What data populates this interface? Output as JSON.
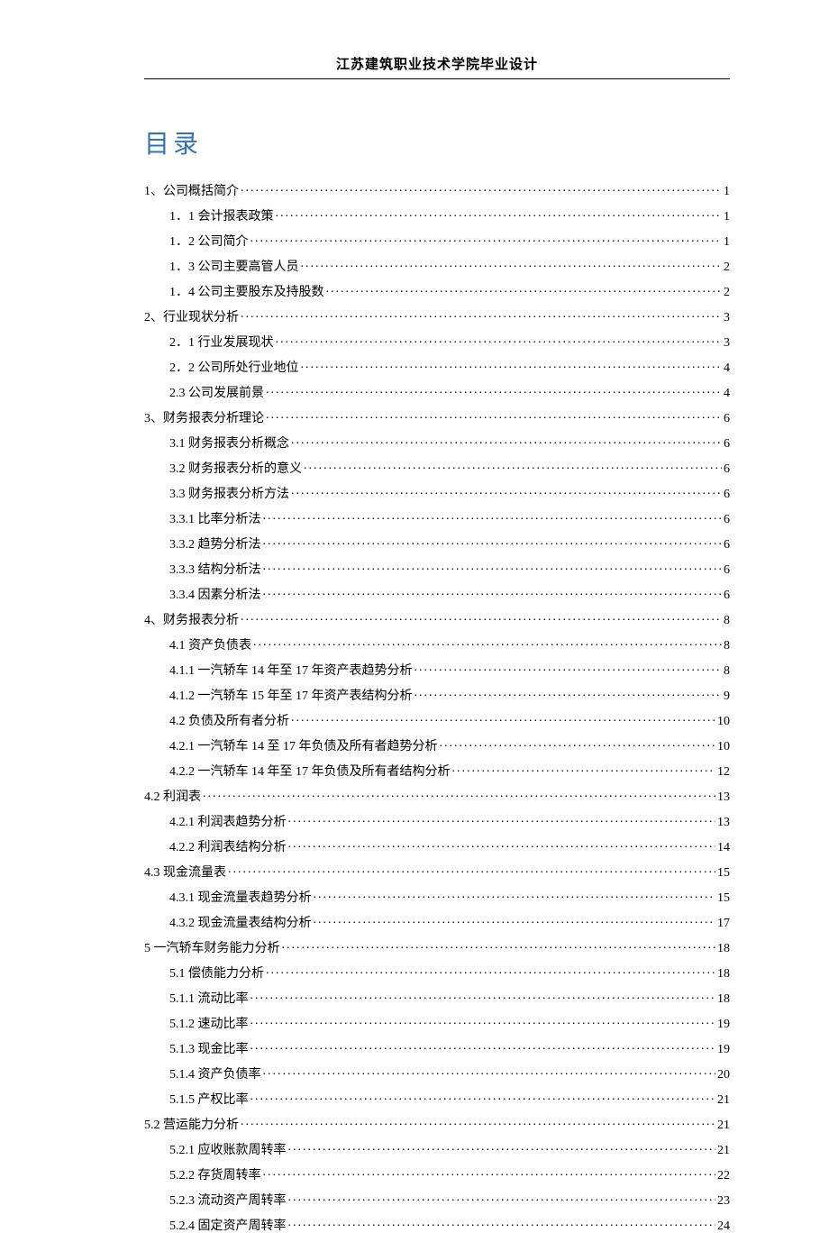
{
  "header": "江苏建筑职业技术学院毕业设计",
  "toc_title": "目录",
  "toc": [
    {
      "level": 1,
      "label": "1、公司概括简介",
      "page": "1"
    },
    {
      "level": 2,
      "label": "1．1 会计报表政策",
      "page": "1"
    },
    {
      "level": 2,
      "label": "1．2 公司简介",
      "page": "1"
    },
    {
      "level": 2,
      "label": "1．3 公司主要高管人员",
      "page": "2"
    },
    {
      "level": 2,
      "label": "1．4 公司主要股东及持股数",
      "page": "2"
    },
    {
      "level": 1,
      "label": "2、行业现状分析",
      "page": "3"
    },
    {
      "level": 2,
      "label": "2．1 行业发展现状",
      "page": "3"
    },
    {
      "level": 2,
      "label": "2．2 公司所处行业地位",
      "page": "4"
    },
    {
      "level": 2,
      "label": "2.3 公司发展前景",
      "page": "4"
    },
    {
      "level": 1,
      "label": "3、财务报表分析理论",
      "page": "6"
    },
    {
      "level": 2,
      "label": "3.1 财务报表分析概念",
      "page": "6"
    },
    {
      "level": 2,
      "label": "3.2 财务报表分析的意义",
      "page": "6"
    },
    {
      "level": 2,
      "label": "3.3 财务报表分析方法",
      "page": "6"
    },
    {
      "level": 2,
      "label": "3.3.1 比率分析法",
      "page": "6"
    },
    {
      "level": 2,
      "label": "3.3.2 趋势分析法",
      "page": "6"
    },
    {
      "level": 2,
      "label": "3.3.3 结构分析法",
      "page": "6"
    },
    {
      "level": 2,
      "label": "3.3.4 因素分析法",
      "page": "6"
    },
    {
      "level": 1,
      "label": "4、财务报表分析",
      "page": "8"
    },
    {
      "level": 2,
      "label": "4.1 资产负债表",
      "page": "8"
    },
    {
      "level": 2,
      "label": "4.1.1 一汽轿车 14 年至 17 年资产表趋势分析",
      "page": "8"
    },
    {
      "level": 2,
      "label": "4.1.2 一汽轿车 15 年至 17 年资产表结构分析",
      "page": "9"
    },
    {
      "level": 2,
      "label": "4.2 负债及所有者分析",
      "page": "10"
    },
    {
      "level": 2,
      "label": "4.2.1 一汽轿车 14 至 17 年负债及所有者趋势分析",
      "page": "10"
    },
    {
      "level": 2,
      "label": "4.2.2 一汽轿车 14 年至 17 年负债及所有者结构分析",
      "page": "12"
    },
    {
      "level": 1,
      "label": "4.2 利润表",
      "page": "13"
    },
    {
      "level": 2,
      "label": "4.2.1 利润表趋势分析",
      "page": "13"
    },
    {
      "level": 2,
      "label": "4.2.2 利润表结构分析",
      "page": "14"
    },
    {
      "level": 1,
      "label": "4.3 现金流量表",
      "page": "15"
    },
    {
      "level": 2,
      "label": "4.3.1 现金流量表趋势分析",
      "page": "15"
    },
    {
      "level": 2,
      "label": "4.3.2 现金流量表结构分析",
      "page": "17"
    },
    {
      "level": 1,
      "label": "5 一汽轿车财务能力分析",
      "page": "18"
    },
    {
      "level": 2,
      "label": "5.1 偿债能力分析",
      "page": "18"
    },
    {
      "level": 2,
      "label": "5.1.1 流动比率",
      "page": "18"
    },
    {
      "level": 2,
      "label": "5.1.2 速动比率",
      "page": "19"
    },
    {
      "level": 2,
      "label": "5.1.3 现金比率",
      "page": "19"
    },
    {
      "level": 2,
      "label": "5.1.4 资产负债率",
      "page": "20"
    },
    {
      "level": 2,
      "label": "5.1.5 产权比率",
      "page": "21"
    },
    {
      "level": 1,
      "label": "5.2 营运能力分析",
      "page": "21"
    },
    {
      "level": 2,
      "label": "5.2.1 应收账款周转率",
      "page": "21"
    },
    {
      "level": 2,
      "label": "5.2.2 存货周转率",
      "page": "22"
    },
    {
      "level": 2,
      "label": "5.2.3 流动资产周转率",
      "page": "23"
    },
    {
      "level": 2,
      "label": "5.2.4 固定资产周转率",
      "page": "24"
    }
  ]
}
